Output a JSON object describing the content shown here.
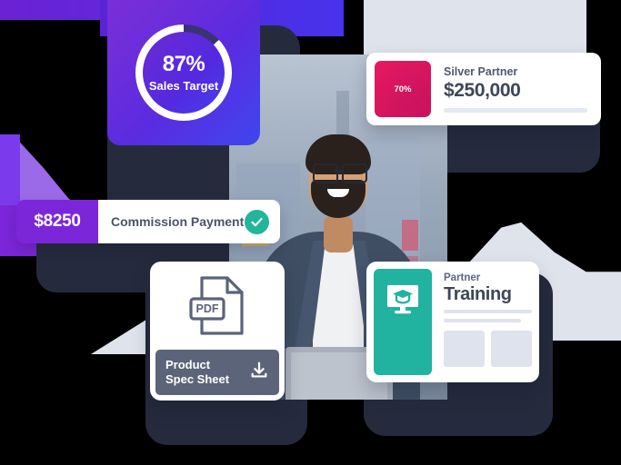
{
  "hero": {
    "alt": "partner-portal-illustration"
  },
  "sales_card": {
    "percent": "87%",
    "label": "Sales Target",
    "gauge_value": 87,
    "gradient_from": "#7b2fd6",
    "gradient_to": "#3f46ee"
  },
  "silver_card": {
    "gauge_percent": "70%",
    "gauge_value": 70,
    "tier_label": "Silver Partner",
    "amount": "$250,000",
    "tile_color": "#d4145a"
  },
  "commission_card": {
    "amount": "$8250",
    "label": "Commission Payment",
    "status_icon": "check-circle-icon",
    "amount_bg": "#7c26d9",
    "status_color": "#22b59a"
  },
  "pdf_card": {
    "file_type": "PDF",
    "title_line1": "Product",
    "title_line2": "Spec Sheet",
    "action_icon": "download-icon",
    "footer_bg": "#5b6478"
  },
  "training_card": {
    "subtitle": "Partner",
    "title": "Training",
    "icon": "monitor-graduation-cap-icon",
    "tile_color": "#22b2a0"
  },
  "photo": {
    "name": "smiling-man-with-laptop-photo"
  }
}
